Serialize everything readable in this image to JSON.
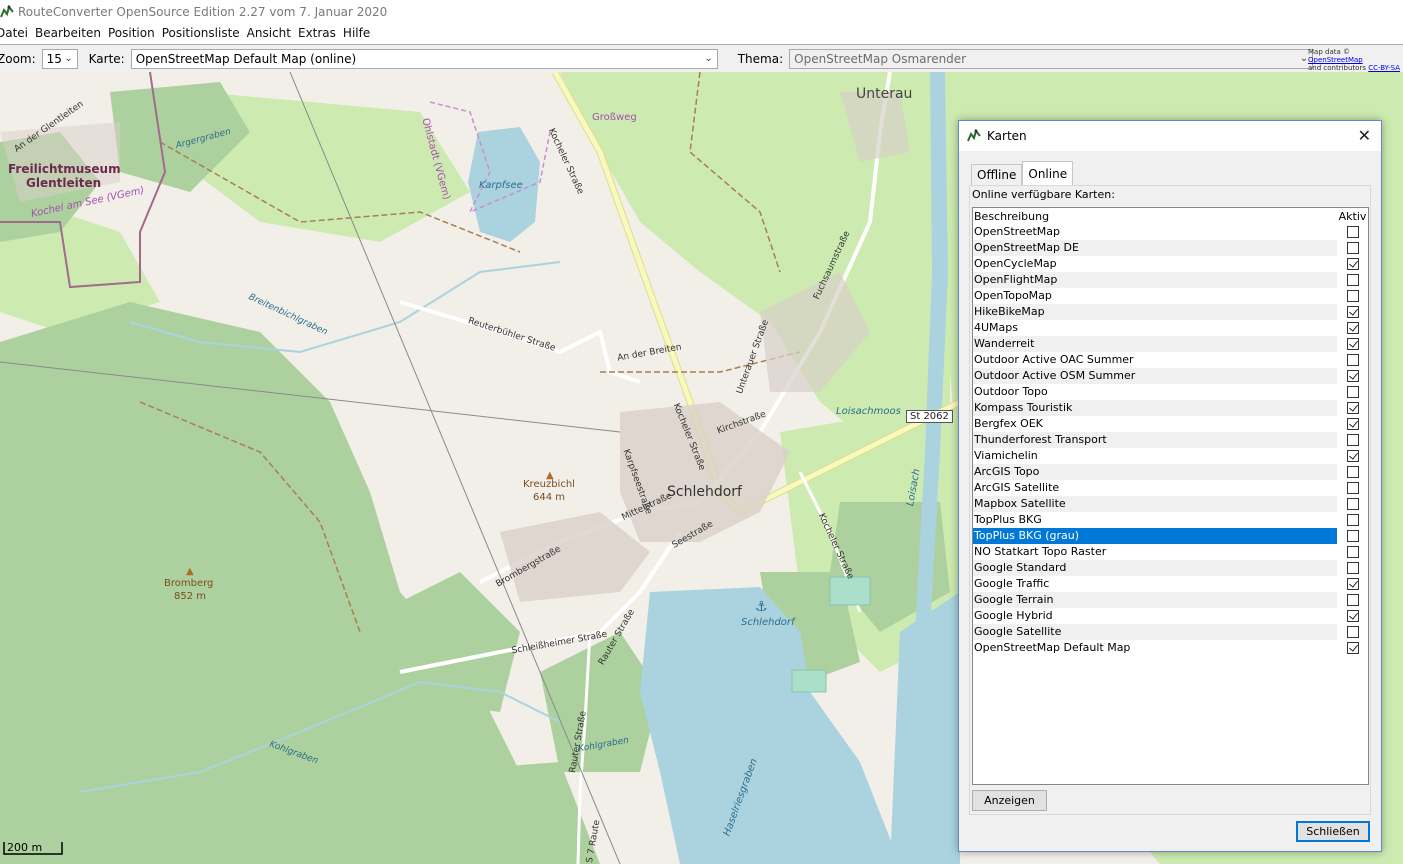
{
  "window": {
    "title": "RouteConverter OpenSource Edition 2.27 vom 7. Januar 2020",
    "app_icon": "routeconverter-icon"
  },
  "menu": [
    "Datei",
    "Bearbeiten",
    "Position",
    "Positionsliste",
    "Ansicht",
    "Extras",
    "Hilfe"
  ],
  "toolbar": {
    "zoom_label": "Zoom:",
    "zoom_value": "15",
    "map_label": "Karte:",
    "map_value": "OpenStreetMap Default Map (online)",
    "theme_label": "Thema:",
    "theme_value": "OpenStreetMap Osmarender",
    "attribution_prefix": "Map data ©",
    "attribution_osm": "OpenStreetMap",
    "attribution_mid": "and contributors",
    "attribution_license": "CC-BY-SA"
  },
  "map": {
    "places": {
      "unterau": "Unterau",
      "schlehdorf": "Schlehdorf",
      "freilicht1": "Freilichtmuseum",
      "freilicht2": "Glentleiten",
      "kreuzbichl": "Kreuzbichl",
      "kreuzbichl_ele": "644 m",
      "bromberg": "Bromberg",
      "bromberg_ele": "852 m",
      "karpfsee": "Karpfsee",
      "ohlstadt": "Ohlstadt (VGem)",
      "grossweg": "Großweg",
      "loisachmoos": "Loisachmoos",
      "schlehdorf_harbor": "Schlehdorf",
      "kochel_vgem": "Kochel am See (VGem)",
      "an_der_glentleiten": "An der Glentleiten",
      "argergraben": "Argergraben",
      "breitenbichlgraben": "Breitenbichlgraben",
      "kohlgraben": "Kohlgraben",
      "kohlgraben2": "Kohlgraben",
      "loisach": "Loisach",
      "haselriesgrabe": "Haselriesgraben"
    },
    "streets": {
      "kocheler1": "Kocheler Straße",
      "kocheler2": "Kocheler Straße",
      "kocheler3": "Kocheler Straße",
      "reuterbuehler": "Reuterbühler Straße",
      "an_der_breiten": "An der Breiten",
      "karpfseestr": "Karpfseestraße",
      "kirchstr": "Kirchstraße",
      "unterauer": "Unterauer Straße",
      "fuchsaum": "Fuchsaumstraße",
      "mittelstr": "Mittelstraße",
      "seestr": "Seestraße",
      "bromberg": "Brombergstraße",
      "schleissheimer": "Schleißheimer Straße",
      "rauter": "Rauter Straße",
      "rauter2": "Rauter Straße",
      "rauter3": "S 7 Raute"
    },
    "route_badge": "St 2062",
    "scale_label": "200 m",
    "colors": {
      "background": "#f2efe9",
      "forest": "#add19e",
      "meadow": "#cdebb0",
      "water": "#aad3df",
      "primary_road": "#fcd6a4",
      "secondary_road": "#f7fabf"
    }
  },
  "dialog": {
    "title": "Karten",
    "icon": "routeconverter-icon",
    "tabs": [
      "Offline",
      "Online"
    ],
    "active_tab": "Online",
    "heading": "Online verfügbare Karten:",
    "col_description": "Beschreibung",
    "col_active": "Aktiv",
    "rows": [
      {
        "name": "OpenStreetMap",
        "active": false
      },
      {
        "name": "OpenStreetMap DE",
        "active": false
      },
      {
        "name": "OpenCycleMap",
        "active": true
      },
      {
        "name": "OpenFlightMap",
        "active": false
      },
      {
        "name": "OpenTopoMap",
        "active": false
      },
      {
        "name": "HikeBikeMap",
        "active": true
      },
      {
        "name": "4UMaps",
        "active": true
      },
      {
        "name": "Wanderreit",
        "active": true
      },
      {
        "name": "Outdoor Active OAC Summer",
        "active": false
      },
      {
        "name": "Outdoor Active OSM Summer",
        "active": true
      },
      {
        "name": "Outdoor Topo",
        "active": false
      },
      {
        "name": "Kompass Touristik",
        "active": true
      },
      {
        "name": "Bergfex OEK",
        "active": true
      },
      {
        "name": "Thunderforest Transport",
        "active": false
      },
      {
        "name": "Viamichelin",
        "active": true
      },
      {
        "name": "ArcGIS Topo",
        "active": false
      },
      {
        "name": "ArcGIS Satellite",
        "active": false
      },
      {
        "name": "Mapbox Satellite",
        "active": false
      },
      {
        "name": "TopPlus BKG",
        "active": false
      },
      {
        "name": "TopPlus BKG (grau)",
        "active": false,
        "selected": true
      },
      {
        "name": "NO Statkart Topo Raster",
        "active": false
      },
      {
        "name": "Google Standard",
        "active": false
      },
      {
        "name": "Google Traffic",
        "active": true
      },
      {
        "name": "Google Terrain",
        "active": false
      },
      {
        "name": "Google Hybrid",
        "active": true
      },
      {
        "name": "Google Satellite",
        "active": false
      },
      {
        "name": "OpenStreetMap Default Map",
        "active": true
      }
    ],
    "show_button": "Anzeigen",
    "close_button": "Schließen"
  }
}
